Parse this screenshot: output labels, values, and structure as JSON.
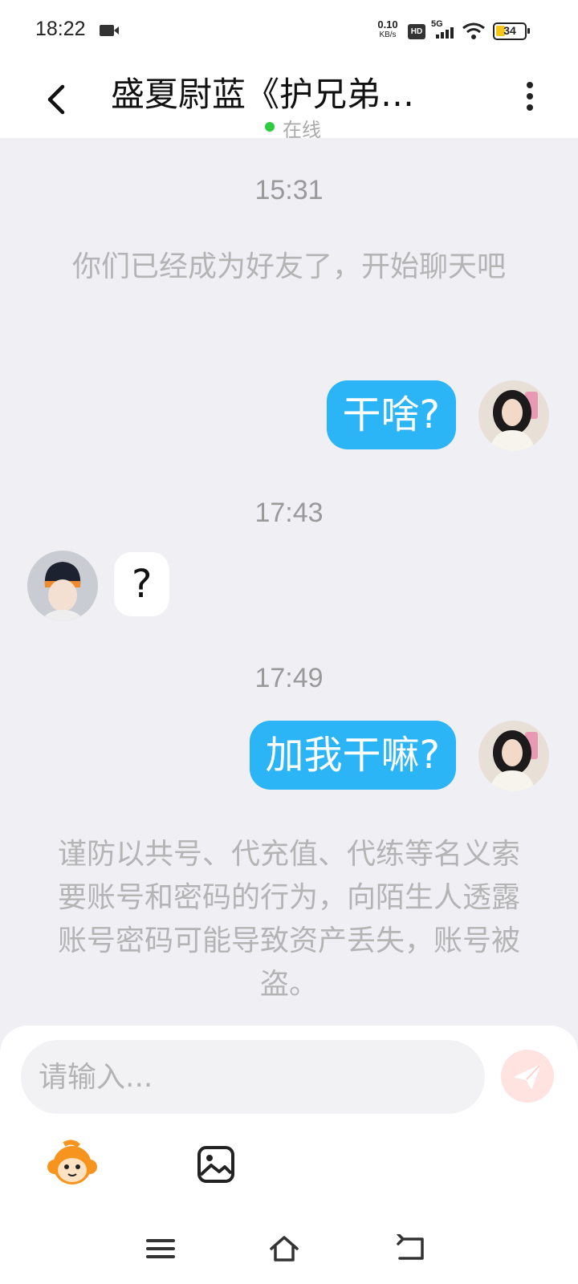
{
  "status_bar": {
    "time": "18:22",
    "net_speed_value": "0.10",
    "net_speed_unit": "KB/s",
    "hd_badge": "HD",
    "network_type": "5G",
    "battery_level": "34",
    "battery_fraction": 0.34,
    "battery_color": "#f5c518"
  },
  "header": {
    "title": "盛夏尉蓝《护兄弟…",
    "online_status": "在线",
    "online_color": "#2ecc40",
    "back_icon": "chevron-left-icon",
    "more_icon": "more-vertical-icon"
  },
  "messages": [
    {
      "type": "time",
      "text": "15:31"
    },
    {
      "type": "system",
      "text": "你们已经成为好友了，开始聊天吧"
    },
    {
      "type": "outgoing",
      "text": "干啥?"
    },
    {
      "type": "time",
      "text": "17:43"
    },
    {
      "type": "incoming",
      "text": "?"
    },
    {
      "type": "time",
      "text": "17:49"
    },
    {
      "type": "outgoing",
      "text": "加我干嘛?"
    },
    {
      "type": "system",
      "text": "谨防以共号、代充值、代练等名义索要账号和密码的行为，向陌生人透露账号密码可能导致资产丢失，账号被盗。"
    }
  ],
  "input": {
    "placeholder": "请输入...",
    "send_icon": "send-icon",
    "emoji_icon": "monkey-emoji-icon",
    "image_icon": "image-icon"
  },
  "colors": {
    "outgoing_bubble": "#2bb5f6",
    "incoming_bubble": "#ffffff",
    "background": "#efeff4",
    "send_button": "#ffe3e0"
  },
  "nav_bar": {
    "menu_icon": "menu-icon",
    "home_icon": "home-icon",
    "back_icon": "back-icon"
  }
}
